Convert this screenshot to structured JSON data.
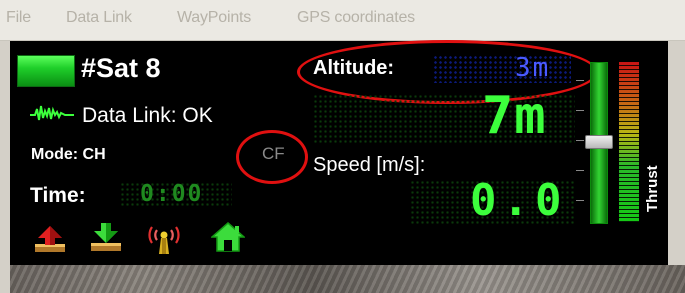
{
  "menu": {
    "items": [
      "File",
      "Data Link",
      "WayPoints",
      "GPS coordinates"
    ]
  },
  "status": {
    "sat_label": "#Sat 8",
    "data_link_label": "Data Link: OK",
    "mode_label": "Mode: CH",
    "cf_badge": "CF",
    "time_label": "Time:",
    "time_value": "0:00"
  },
  "altitude": {
    "label": "Altitude:",
    "value": "3m",
    "big_value": "7m"
  },
  "speed": {
    "label": "Speed [m/s]:",
    "value": "0.0"
  },
  "thrust": {
    "label": "Thrust"
  },
  "toolbar": {
    "icons": [
      "upload-icon",
      "download-icon",
      "antenna-icon",
      "home-icon"
    ]
  },
  "colors": {
    "led_green": "#3cff3c",
    "led_blue": "#4a5aff",
    "annotation_red": "#e01010"
  }
}
